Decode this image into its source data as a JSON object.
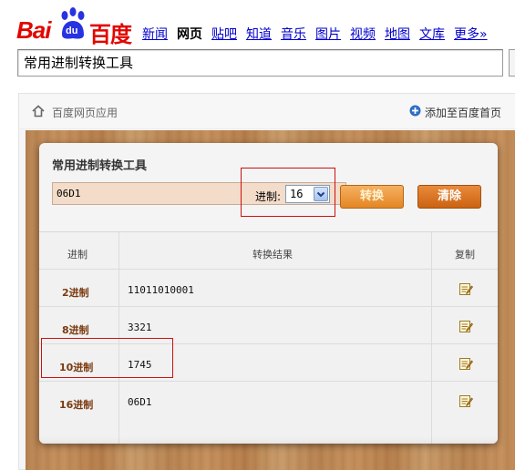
{
  "header": {
    "logo_bai": "Bai",
    "logo_du": "du",
    "logo_cn": "百度",
    "nav": [
      "新闻",
      "网页",
      "贴吧",
      "知道",
      "音乐",
      "图片",
      "视频",
      "地图",
      "文库",
      "更多»"
    ],
    "active_nav": "网页",
    "search_value": "常用进制转换工具"
  },
  "app_bar": {
    "title": "百度网页应用",
    "add_link": "添加至百度首页"
  },
  "converter": {
    "title": "常用进制转换工具",
    "input_value": "06D1",
    "base_label": "进制:",
    "base_selected": "16",
    "convert_label": "转换",
    "clear_label": "清除",
    "table": {
      "headers": [
        "进制",
        "转换结果",
        "复制"
      ],
      "rows": [
        {
          "base": "2进制",
          "result": "11011010001"
        },
        {
          "base": "8进制",
          "result": "3321"
        },
        {
          "base": "10进制",
          "result": "1745"
        },
        {
          "base": "16进制",
          "result": "06D1"
        }
      ]
    }
  },
  "colors": {
    "brand_red": "#e10601",
    "brand_blue": "#2932e1",
    "link_blue": "#0000cc",
    "highlight_red": "#cc1010",
    "button_orange": "#e38624"
  },
  "icons": {
    "home": "home-icon",
    "add": "plus-circle-icon",
    "copy": "copy-note-icon"
  }
}
